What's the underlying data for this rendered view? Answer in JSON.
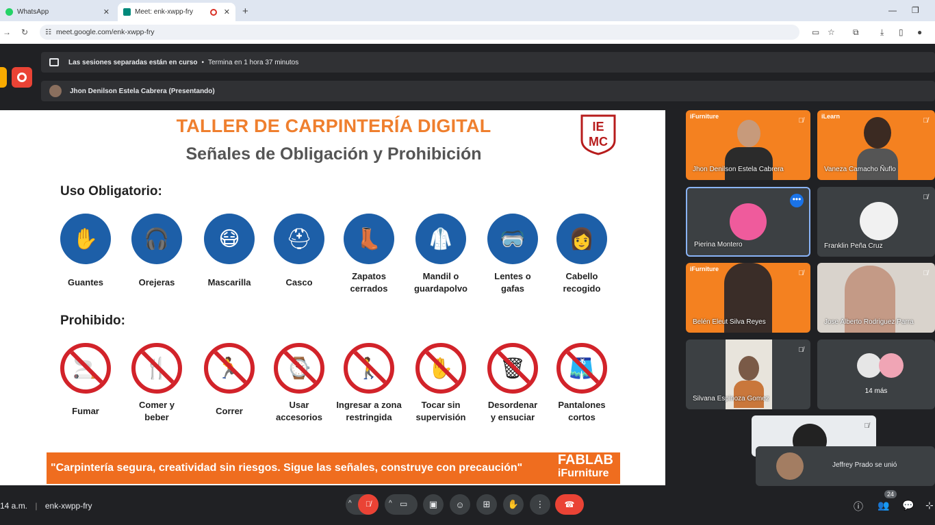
{
  "browser": {
    "tabs": [
      {
        "label": "WhatsApp",
        "icon": "whatsapp-icon"
      },
      {
        "label": "Meet: enk-xwpp-fry",
        "icon": "meet-icon"
      }
    ],
    "url": "meet.google.com/enk-xwpp-fry"
  },
  "meet": {
    "breakout_banner": {
      "text": "Las sesiones separadas están en curso",
      "sep": "•",
      "remaining": "Termina en 1 hora 37 minutos"
    },
    "presenter_banner": "Jhon Denilson Estela Cabrera (Presentando)",
    "meeting_time": "14 a.m.",
    "meeting_code": "enk-xwpp-fry",
    "participant_count": "24",
    "join_toast": "Jeffrey Prado se unió"
  },
  "slide": {
    "title": "TALLER DE CARPINTERÍA DIGITAL",
    "subtitle": "Señales de Obligación y Prohibición",
    "logo_text": {
      "top": "IE",
      "bottom": "MC"
    },
    "mandatory_heading": "Uso Obligatorio:",
    "mandatory": [
      {
        "l1": "Guantes",
        "l2": ""
      },
      {
        "l1": "Orejeras",
        "l2": ""
      },
      {
        "l1": "Mascarilla",
        "l2": ""
      },
      {
        "l1": "Casco",
        "l2": ""
      },
      {
        "l1": "Zapatos",
        "l2": "cerrados"
      },
      {
        "l1": "Mandil o",
        "l2": "guardapolvo"
      },
      {
        "l1": "Lentes o",
        "l2": "gafas"
      },
      {
        "l1": "Cabello",
        "l2": "recogido"
      }
    ],
    "prohibited_heading": "Prohibido:",
    "prohibited": [
      {
        "l1": "Fumar",
        "l2": ""
      },
      {
        "l1": "Comer y",
        "l2": "beber"
      },
      {
        "l1": "Correr",
        "l2": ""
      },
      {
        "l1": "Usar",
        "l2": "accesorios"
      },
      {
        "l1": "Ingresar a zona",
        "l2": "restringida"
      },
      {
        "l1": "Tocar sin",
        "l2": "supervisión"
      },
      {
        "l1": "Desordenar",
        "l2": "y ensuciar"
      },
      {
        "l1": "Pantalones",
        "l2": "cortos"
      }
    ],
    "footer_quote": "\"Carpintería segura, creatividad sin riesgos. Sigue las señales, construye con precaución\"",
    "footer_brand_l1": "FABLAB",
    "footer_brand_l2": "iFurniture"
  },
  "participants": [
    {
      "name": "Jhon Denilson Estela Cabrera",
      "brand": "iFurniture"
    },
    {
      "name": "Vaneza Camacho Ñuflo",
      "brand": "iLearn"
    },
    {
      "name": "Pierina Montero"
    },
    {
      "name": "Franklin Peña Cruz"
    },
    {
      "name": "Belén Eleut Silva Reyes",
      "brand": "iFurniture"
    },
    {
      "name": "Jose Alberto Rodriguez Parra"
    },
    {
      "name": "Silvana Espinoza Gomez"
    },
    {
      "name": "14 más"
    }
  ],
  "colors": {
    "orange": "#ef7f2e",
    "blue": "#1d5fa8",
    "red": "#d2232a",
    "hangup": "#ea4335"
  }
}
